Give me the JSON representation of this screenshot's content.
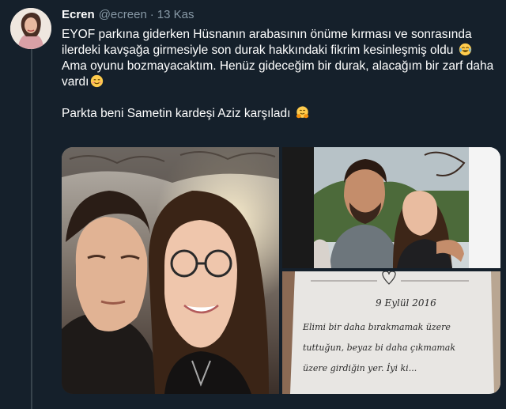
{
  "tweet": {
    "display_name": "Ecren",
    "handle": "@ecreen",
    "separator": "·",
    "date": "13 Kas",
    "paragraph1": "EYOF parkına giderken Hüsnanın arabasının önüme kırması ve sonrasında ilerdeki kavşağa girmesiyle son durak hakkındaki fikrim kesinleşmiş oldu",
    "paragraph1_emoji": "joy-emoji",
    "paragraph2": "Ama oyunu bozmayacaktım. Henüz gideceğim bir durak, alacağım bir zarf daha vardı",
    "paragraph2_emoji": "smiling-emoji",
    "paragraph3": "Parkta beni Sametin kardeşi Aziz karşıladı",
    "paragraph3_emoji": "hugging-emoji"
  },
  "media": {
    "photos": [
      {
        "name": "selfie-photo"
      },
      {
        "name": "couple-photo"
      },
      {
        "name": "handwritten-note-photo"
      }
    ],
    "note": {
      "date_line": "9 Eylül 2016",
      "line1": "Elimi bir daha bırakmamak üzere",
      "line2": "tuttuğun, beyaz bi daha çıkmamak",
      "line3": "üzere girdiğin yer. İyi ki..."
    }
  },
  "colors": {
    "background": "#15202b",
    "secondary_text": "#8899a6",
    "thread_line": "#38444d"
  }
}
